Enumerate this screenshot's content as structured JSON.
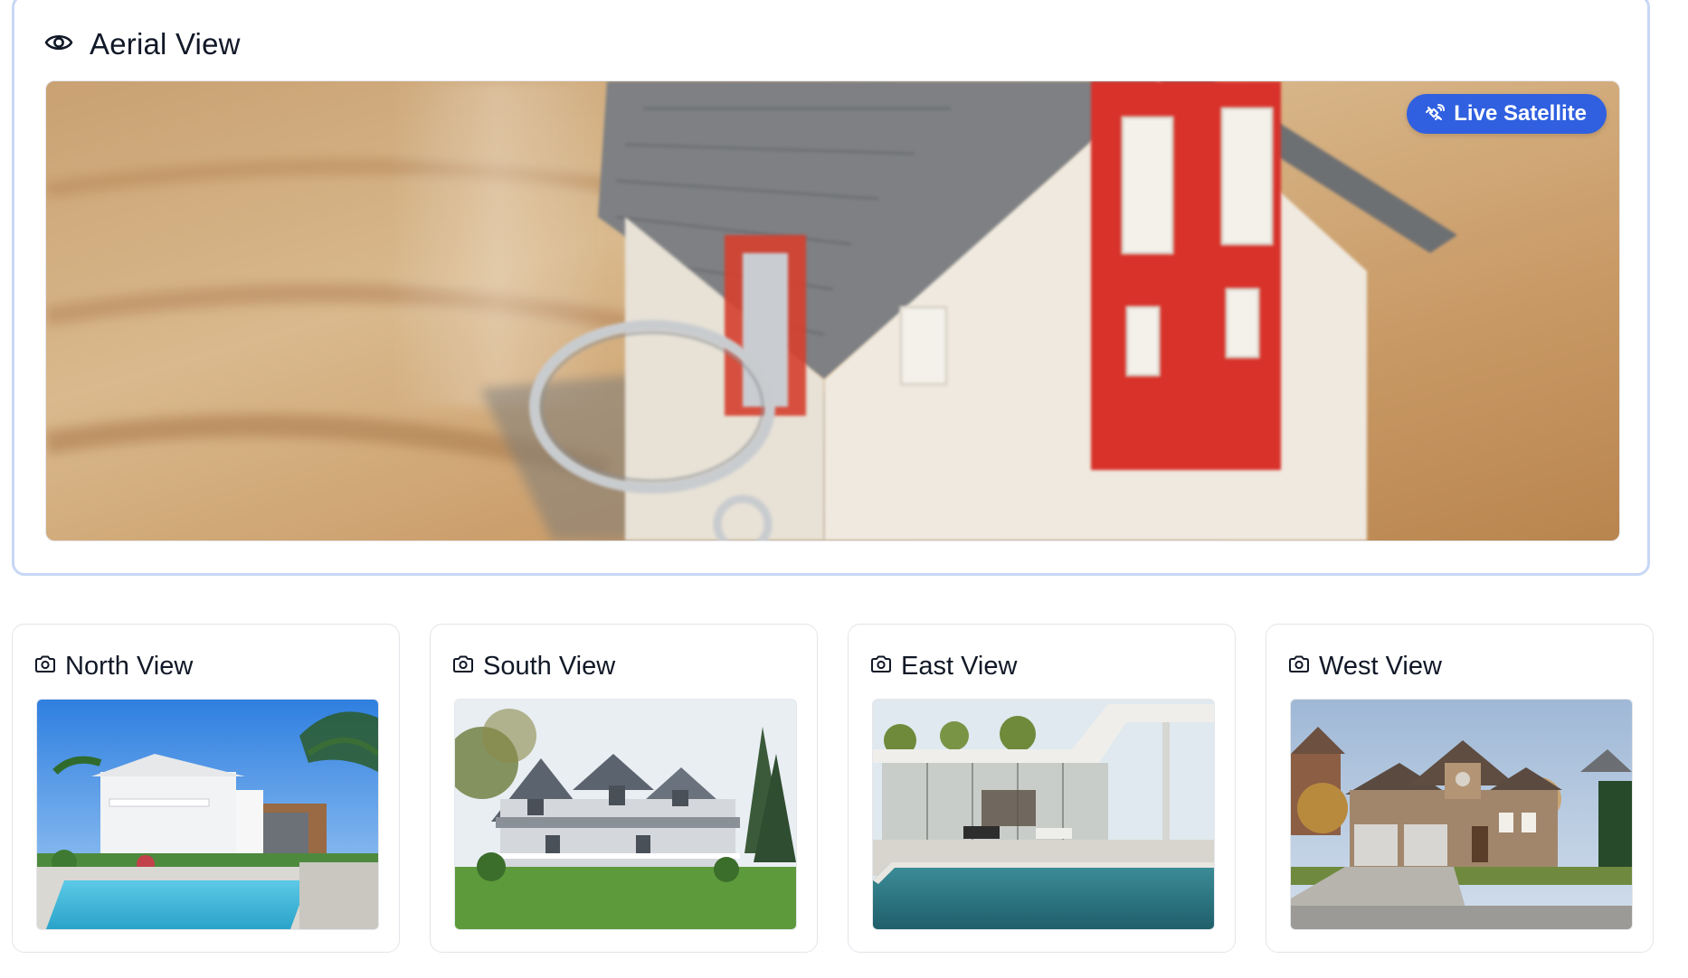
{
  "aerial": {
    "title": "Aerial View",
    "header_icon": "eye-icon",
    "image_alt": "model house with keys",
    "badge": {
      "label": "Live Satellite",
      "icon": "satellite-icon",
      "color": "#3060e0"
    }
  },
  "views": [
    {
      "title": "North View",
      "icon": "camera-icon",
      "image_alt": "white house with pool"
    },
    {
      "title": "South View",
      "icon": "camera-icon",
      "image_alt": "gray farmhouse with porch"
    },
    {
      "title": "East View",
      "icon": "camera-icon",
      "image_alt": "modern house with pool"
    },
    {
      "title": "West View",
      "icon": "camera-icon",
      "image_alt": "brick suburban house"
    }
  ],
  "colors": {
    "accent": "#3060e0",
    "aerial_border": "#c7d7f5",
    "card_border": "#e3e5ea"
  }
}
